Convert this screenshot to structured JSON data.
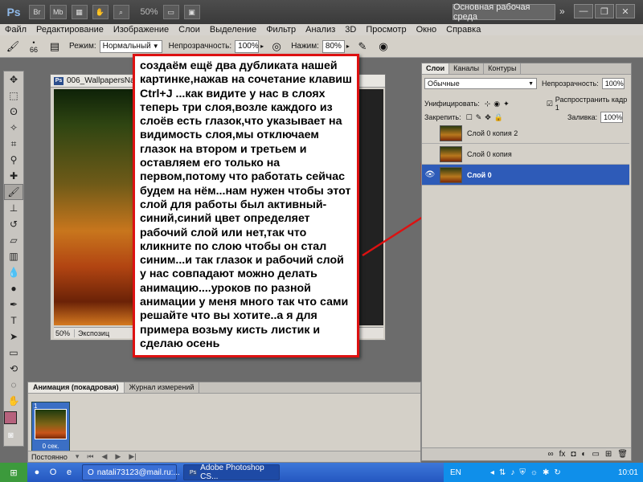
{
  "app": {
    "logo": "Ps",
    "bar_buttons": [
      "Br",
      "Mb"
    ],
    "zoom": "50%",
    "workspace": "Основная рабочая среда",
    "window_controls": [
      "—",
      "❐",
      "✕"
    ]
  },
  "menu": [
    "Файл",
    "Редактирование",
    "Изображение",
    "Слои",
    "Выделение",
    "Фильтр",
    "Анализ",
    "3D",
    "Просмотр",
    "Окно",
    "Справка"
  ],
  "options": {
    "brush_size": "66",
    "mode_label": "Режим:",
    "mode_value": "Нормальный",
    "opacity_label": "Непрозрачность:",
    "opacity_value": "100%",
    "pressure_label": "Нажим:",
    "pressure_value": "80%"
  },
  "document": {
    "title": "006_WallpapersNa",
    "zoom": "50%",
    "status": "Экспозиц"
  },
  "note": {
    "text": "создаём ещё два дубликата нашей картинке,нажав на сочетание клавиш  Ctrl+J ...как видите у нас в слоях теперь три слоя,возле каждого из слоёв есть глазок,что указывает на видимость слоя,мы отключаем глазок на втором и третьем и оставляем его только на первом,потому что работать сейчас будем на нём...нам нужен чтобы этот слой для работы был активный- синий,синий цвет определяет рабочий слой или нет,так что кликните по слою чтобы он стал синим...и так глазок и рабочий слой у нас совпадают можно делать анимацию....уроков по разной анимации у меня много так что сами решайте что вы хотите..а я для примера возьму кисть листик и сделаю осень"
  },
  "animation": {
    "tabs": [
      "Анимация (покадровая)",
      "Журнал измерений"
    ],
    "frame_number": "1",
    "frame_delay": "0 сек.",
    "loop": "Постоянно"
  },
  "layers": {
    "tabs": [
      "Слои",
      "Каналы",
      "Контуры"
    ],
    "blend_mode": "Обычные",
    "opacity_label": "Непрозрачность:",
    "opacity_value": "100%",
    "unify_label": "Унифицировать:",
    "propagate_label": "Распространить кадр 1",
    "lock_label": "Закрепить:",
    "fill_label": "Заливка:",
    "fill_value": "100%",
    "items": [
      {
        "name": "Слой 0 копия 2",
        "visible": false,
        "selected": false
      },
      {
        "name": "Слой 0 копия",
        "visible": false,
        "selected": false
      },
      {
        "name": "Слой 0",
        "visible": true,
        "selected": true
      }
    ]
  },
  "taskbar": {
    "task1": "natali73123@mail.ru:...",
    "task2": "Adobe Photoshop CS...",
    "lang": "EN",
    "clock": "10:01"
  },
  "colors": {
    "accent_red": "#dd1111",
    "selected_layer": "#2e5bb8",
    "foreground_swatch": "#b6627d"
  }
}
